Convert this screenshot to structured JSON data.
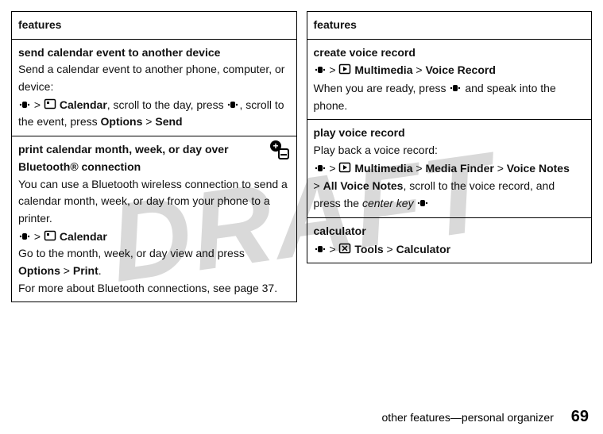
{
  "watermark": "DRAFT",
  "left": {
    "header": "features",
    "rows": [
      {
        "title": "send calendar event to another device",
        "body1": "Send a calendar event to another phone, computer, or device:",
        "path_prefix": " > ",
        "cal": "Calendar",
        "path_mid": ", scroll to the day, press ",
        "path_suffix": ", scroll to the event, press ",
        "opt": "Options",
        "gt": " > ",
        "send": "Send"
      },
      {
        "title": "print calendar month, week, or day over Bluetooth® connection",
        "body1": "You can use a Bluetooth wireless connection to send a calendar month, week, or day from your phone to a printer.",
        "path_prefix": " > ",
        "cal": "Calendar",
        "body2": "Go to the month, week, or day view and press ",
        "opt": "Options",
        "gt": " > ",
        "print": "Print",
        "body3": "For more about Bluetooth connections, see page 37."
      }
    ]
  },
  "right": {
    "header": "features",
    "rows": [
      {
        "title": "create voice record",
        "path_prefix": " > ",
        "mm": "Multimedia",
        "gt": " > ",
        "vr": "Voice Record",
        "body1": "When you are ready, press ",
        "body2": " and speak into the phone."
      },
      {
        "title": "play voice record",
        "body1": "Play back a voice record:",
        "path_prefix": " > ",
        "mm": "Multimedia",
        "gt": " > ",
        "mf": "Media Finder",
        "vn": "Voice Notes",
        "avn": "All Voice Notes",
        "body2": ", scroll to the voice record, and press the ",
        "ck": "center key"
      },
      {
        "title": "calculator",
        "path_prefix": " > ",
        "tools": "Tools",
        "gt": " > ",
        "calc": "Calculator"
      }
    ]
  },
  "footer": {
    "section": "other features—personal organizer",
    "page": "69"
  }
}
